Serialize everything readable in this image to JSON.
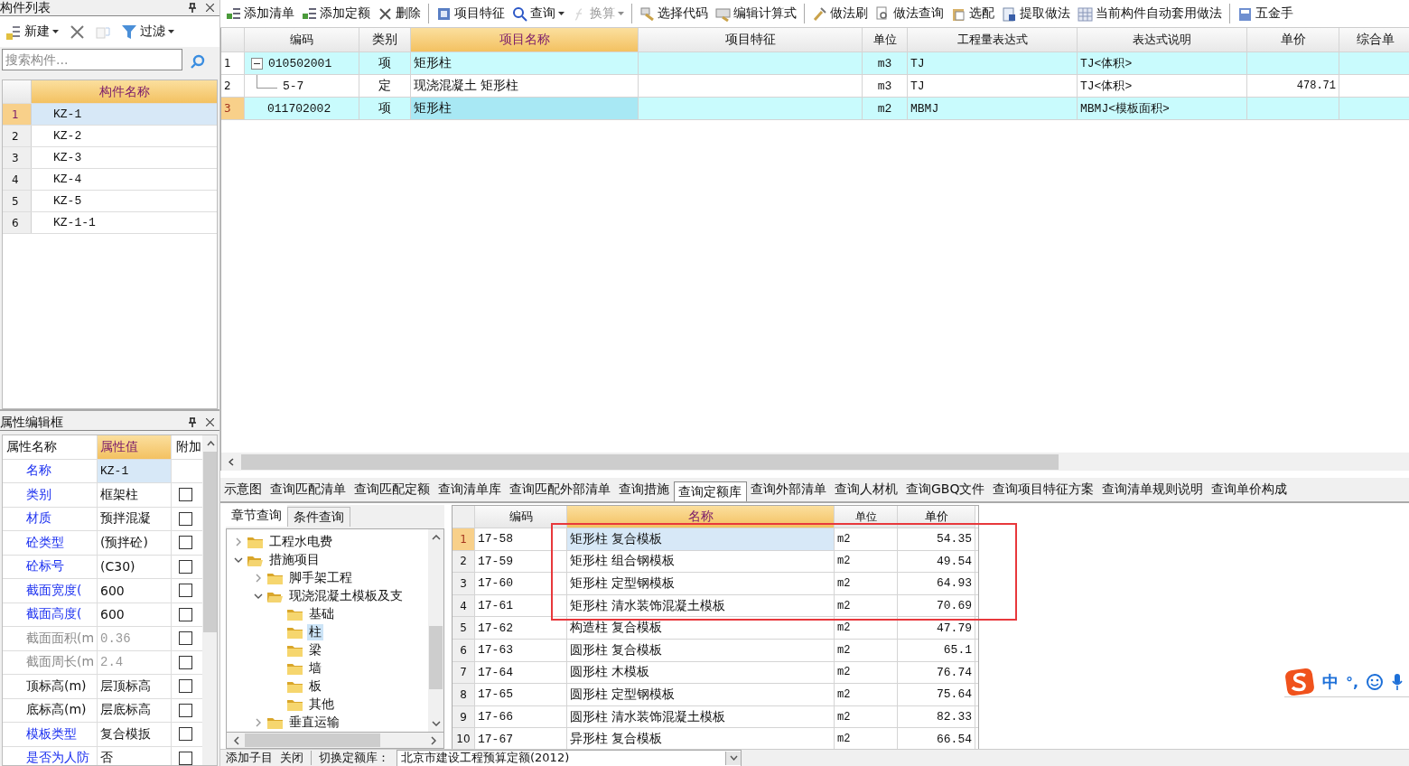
{
  "component_panel": {
    "title": "构件列表",
    "toolbar": [
      {
        "label": "新建",
        "dropdown": true,
        "disabled": false
      },
      {
        "dropdown": false,
        "disabled": false
      },
      {
        "dropdown": false,
        "disabled": true
      },
      {
        "label": "过滤",
        "dropdown": true,
        "disabled": false
      }
    ],
    "search": {
      "placeholder": "搜索构件..."
    },
    "columns": [
      {
        "label": "构件名称",
        "selected": true
      }
    ],
    "rows": [
      {
        "num": "1",
        "name": "KZ-1",
        "selected": true
      },
      {
        "num": "2",
        "name": "KZ-2",
        "selected": false
      },
      {
        "num": "3",
        "name": "KZ-3",
        "selected": false
      },
      {
        "num": "4",
        "name": "KZ-4",
        "selected": false
      },
      {
        "num": "5",
        "name": "KZ-5",
        "selected": false
      },
      {
        "num": "6",
        "name": "KZ-1-1",
        "selected": false
      }
    ]
  },
  "property_panel": {
    "title": "属性编辑框",
    "columns": [
      {
        "label": "属性名称",
        "selected": false
      },
      {
        "label": "属性值",
        "selected": true
      },
      {
        "label": "附加",
        "selected": false
      }
    ],
    "rows": [
      {
        "name": "名称",
        "value": "KZ-1",
        "kind": "link",
        "selected": true
      },
      {
        "name": "类别",
        "value": "框架柱",
        "kind": "link",
        "selected": false,
        "checked": false
      },
      {
        "name": "材质",
        "value": "预拌混凝",
        "kind": "link",
        "selected": false,
        "checked": false
      },
      {
        "name": "砼类型",
        "value": "(预拌砼)",
        "kind": "link",
        "selected": false,
        "checked": false
      },
      {
        "name": "砼标号",
        "value": "(C30)",
        "kind": "link",
        "selected": false,
        "checked": false
      },
      {
        "name": "截面宽度(",
        "value": "600",
        "kind": "link",
        "selected": false,
        "checked": false
      },
      {
        "name": "截面高度(",
        "value": "600",
        "kind": "link",
        "selected": false,
        "checked": false
      },
      {
        "name": "截面面积(m",
        "value": "0.36",
        "kind": "computed",
        "selected": false,
        "checked": false
      },
      {
        "name": "截面周长(m",
        "value": "2.4",
        "kind": "computed",
        "selected": false,
        "checked": false
      },
      {
        "name": "顶标高(m)",
        "value": "层顶标高",
        "kind": "plain",
        "selected": false,
        "checked": false
      },
      {
        "name": "底标高(m)",
        "value": "层底标高",
        "kind": "plain",
        "selected": false,
        "checked": false
      },
      {
        "name": "模板类型",
        "value": "复合模扳",
        "kind": "link",
        "selected": false,
        "checked": false
      },
      {
        "name": "是否为人防",
        "value": "否",
        "kind": "link",
        "selected": false,
        "checked": false
      }
    ]
  },
  "toolbar": [
    {
      "label": "添加清单",
      "dropdown": false,
      "disabled": false
    },
    {
      "label": "添加定额",
      "dropdown": false,
      "disabled": false
    },
    {
      "label": "删除",
      "dropdown": false,
      "disabled": false
    },
    {
      "label": "项目特征",
      "dropdown": false,
      "disabled": false
    },
    {
      "label": "查询",
      "dropdown": true,
      "disabled": false
    },
    {
      "label": "换算",
      "dropdown": true,
      "disabled": true
    },
    {
      "label": "选择代码",
      "dropdown": false,
      "disabled": false
    },
    {
      "label": "编辑计算式",
      "dropdown": false,
      "disabled": false
    },
    {
      "label": "做法刷",
      "dropdown": false,
      "disabled": false
    },
    {
      "label": "做法查询",
      "dropdown": false,
      "disabled": false
    },
    {
      "label": "选配",
      "dropdown": false,
      "disabled": false
    },
    {
      "label": "提取做法",
      "dropdown": false,
      "disabled": false
    },
    {
      "label": "当前构件自动套用做法",
      "dropdown": false,
      "disabled": false
    },
    {
      "label": "五金手",
      "dropdown": false,
      "disabled": false
    }
  ],
  "table": {
    "columns": [
      {
        "label": "编码",
        "selected": false
      },
      {
        "label": "类别",
        "selected": false
      },
      {
        "label": "项目名称",
        "selected": true
      },
      {
        "label": "项目特征",
        "selected": false
      },
      {
        "label": "单位",
        "selected": false
      },
      {
        "label": "工程量表达式",
        "selected": false
      },
      {
        "label": "表达式说明",
        "selected": false
      },
      {
        "label": "单价",
        "selected": false
      },
      {
        "label": "综合单",
        "selected": false
      }
    ],
    "rows": [
      {
        "num": "1",
        "kind": "bill",
        "expanded": true,
        "selected": false,
        "cells": [
          "010502001",
          "项",
          "矩形柱",
          "",
          "m3",
          "TJ",
          "TJ<体积>",
          "",
          ""
        ]
      },
      {
        "num": "2",
        "kind": "quota",
        "selected": false,
        "cells": [
          "5-7",
          "定",
          "现浇混凝土 矩形柱",
          "",
          "m3",
          "TJ",
          "TJ<体积>",
          "478.71",
          ""
        ]
      },
      {
        "num": "3",
        "kind": "bill",
        "selected": true,
        "cells": [
          "011702002",
          "项",
          "矩形柱",
          "",
          "m2",
          "MBMJ",
          "MBMJ<模板面积>",
          "",
          ""
        ]
      }
    ]
  },
  "query_tabs": [
    {
      "label": "示意图",
      "selected": false
    },
    {
      "label": "查询匹配清单",
      "selected": false
    },
    {
      "label": "查询匹配定额",
      "selected": false
    },
    {
      "label": "查询清单库",
      "selected": false
    },
    {
      "label": "查询匹配外部清单",
      "selected": false
    },
    {
      "label": "查询措施",
      "selected": false
    },
    {
      "label": "查询定额库",
      "selected": true
    },
    {
      "label": "查询外部清单",
      "selected": false
    },
    {
      "label": "查询人材机",
      "selected": false
    },
    {
      "label": "查询GBQ文件",
      "selected": false
    },
    {
      "label": "查询项目特征方案",
      "selected": false
    },
    {
      "label": "查询清单规则说明",
      "selected": false
    },
    {
      "label": "查询单价构成",
      "selected": false
    }
  ],
  "chapter_tabs": [
    {
      "label": "章节查询",
      "selected": true
    },
    {
      "label": "条件查询",
      "selected": false
    }
  ],
  "tree": [
    {
      "label": "工程水电费",
      "expanded": false,
      "selected": false
    },
    {
      "label": "措施项目",
      "expanded": true,
      "selected": false,
      "children": [
        {
          "label": "脚手架工程",
          "expanded": false,
          "selected": false
        },
        {
          "label": "现浇混凝土模板及支",
          "expanded": true,
          "selected": false,
          "children": [
            {
              "label": "基础",
              "selected": false
            },
            {
              "label": "柱",
              "selected": true
            },
            {
              "label": "梁",
              "selected": false
            },
            {
              "label": "墙",
              "selected": false
            },
            {
              "label": "板",
              "selected": false
            },
            {
              "label": "其他",
              "selected": false
            }
          ]
        },
        {
          "label": "垂直运输",
          "expanded": false,
          "selected": false
        }
      ]
    }
  ],
  "quota_table": {
    "columns": [
      {
        "label": "编码",
        "selected": false
      },
      {
        "label": "名称",
        "selected": true
      },
      {
        "label": "单位",
        "selected": false
      },
      {
        "label": "单价",
        "selected": false
      }
    ],
    "rows": [
      {
        "num": "1",
        "selected": true,
        "highlighted": true,
        "cells": [
          "17-58",
          "矩形柱 复合模板",
          "m2",
          "54.35"
        ]
      },
      {
        "num": "2",
        "selected": false,
        "highlighted": true,
        "cells": [
          "17-59",
          "矩形柱 组合钢模板",
          "m2",
          "49.54"
        ]
      },
      {
        "num": "3",
        "selected": false,
        "highlighted": true,
        "cells": [
          "17-60",
          "矩形柱 定型钢模板",
          "m2",
          "64.93"
        ]
      },
      {
        "num": "4",
        "selected": false,
        "highlighted": true,
        "cells": [
          "17-61",
          "矩形柱 清水装饰混凝土模板",
          "m2",
          "70.69"
        ]
      },
      {
        "num": "5",
        "selected": false,
        "highlighted": false,
        "cells": [
          "17-62",
          "构造柱 复合模板",
          "m2",
          "47.79"
        ]
      },
      {
        "num": "6",
        "selected": false,
        "highlighted": false,
        "cells": [
          "17-63",
          "圆形柱 复合模板",
          "m2",
          "65.1"
        ]
      },
      {
        "num": "7",
        "selected": false,
        "highlighted": false,
        "cells": [
          "17-64",
          "圆形柱 木模板",
          "m2",
          "76.74"
        ]
      },
      {
        "num": "8",
        "selected": false,
        "highlighted": false,
        "cells": [
          "17-65",
          "圆形柱 定型钢模板",
          "m2",
          "75.64"
        ]
      },
      {
        "num": "9",
        "selected": false,
        "highlighted": false,
        "cells": [
          "17-66",
          "圆形柱 清水装饰混凝土模板",
          "m2",
          "82.33"
        ]
      },
      {
        "num": "10",
        "selected": false,
        "highlighted": false,
        "cells": [
          "17-67",
          "异形柱 复合模板",
          "m2",
          "66.54"
        ]
      }
    ]
  },
  "status_bar": {
    "buttons": [
      "添加子目",
      "关闭"
    ],
    "library_label": "切换定额库：",
    "library_value": "北京市建设工程预算定额(2012)"
  },
  "ime_bar": {
    "mode": "中",
    "punct": "°,"
  }
}
